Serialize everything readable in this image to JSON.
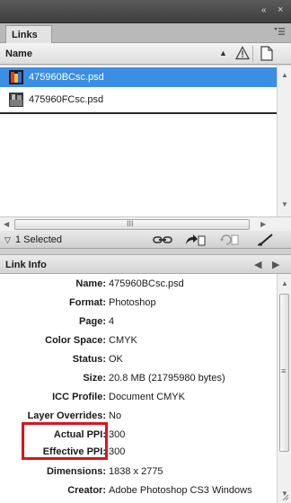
{
  "window": {
    "collapse_icon": "double-chevron-left-icon",
    "close_icon": "close-icon",
    "collapse_glyph": "«",
    "close_glyph": "×"
  },
  "panel": {
    "tab_label": "Links",
    "menu_icon": "panel-menu-icon"
  },
  "list": {
    "column_name": "Name",
    "items": [
      {
        "filename": "475960BCsc.psd",
        "selected": true
      },
      {
        "filename": "475960FCsc.psd",
        "selected": false
      }
    ],
    "scroll_grip": "III"
  },
  "status": {
    "selected_text": "1 Selected",
    "icons": [
      "relink-icon",
      "go-to-link-icon",
      "update-link-icon",
      "edit-original-icon"
    ]
  },
  "link_info": {
    "title": "Link Info",
    "rows": [
      {
        "label": "Name:",
        "value": "475960BCsc.psd"
      },
      {
        "label": "Format:",
        "value": "Photoshop"
      },
      {
        "label": "Page:",
        "value": "4"
      },
      {
        "label": "Color Space:",
        "value": "CMYK"
      },
      {
        "label": "Status:",
        "value": "OK"
      },
      {
        "label": "Size:",
        "value": "20.8 MB (21795980 bytes)"
      },
      {
        "label": "ICC Profile:",
        "value": "Document CMYK"
      },
      {
        "label": "Layer Overrides:",
        "value": "No"
      },
      {
        "label": "Actual PPI:",
        "value": "300"
      },
      {
        "label": "Effective PPI:",
        "value": "300"
      },
      {
        "label": "Dimensions:",
        "value": "1838 x 2775"
      },
      {
        "label": "Creator:",
        "value": "Adobe Photoshop CS3 Windows"
      }
    ]
  },
  "colors": {
    "selection": "#3b8ee4",
    "highlight_box": "#e0121c",
    "title_bar": "#4a4a4a"
  }
}
